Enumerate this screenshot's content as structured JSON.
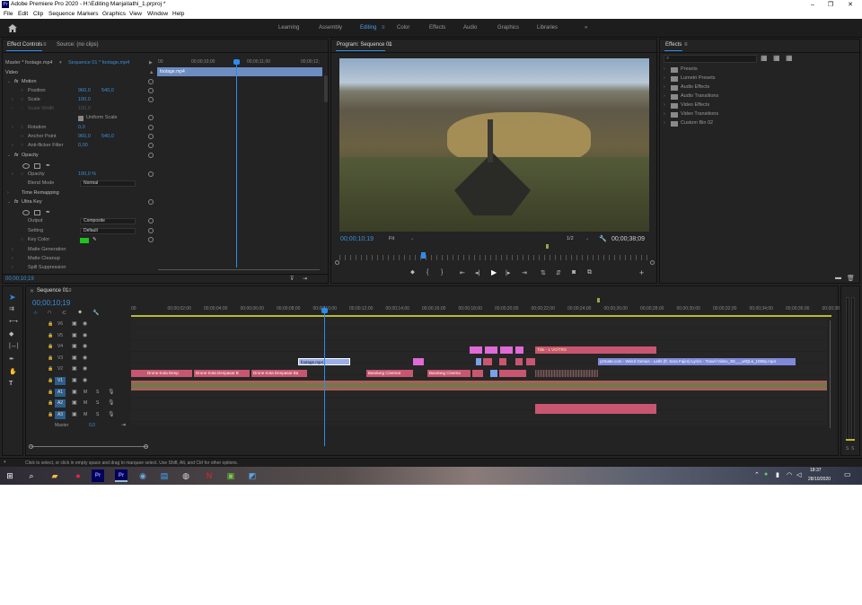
{
  "window": {
    "title": "Adobe Premiere Pro 2020 - H:\\Editing Manja\\lathi_1.prproj *",
    "app_badge": "Pr"
  },
  "menu": [
    "File",
    "Edit",
    "Clip",
    "Sequence",
    "Markers",
    "Graphics",
    "View",
    "Window",
    "Help"
  ],
  "workspaces": [
    "Learning",
    "Assembly",
    "Editing",
    "Color",
    "Effects",
    "Audio",
    "Graphics",
    "Libraries"
  ],
  "active_workspace": "Editing",
  "effect_controls": {
    "tab_label": "Effect Controls",
    "menu_glyph": "≡",
    "source_tab": "Source: (no clips)",
    "master_label": "Master * footage.mp4",
    "sequence_label": "Sequence 01 * footage.mp4",
    "timecodes": [
      "00",
      "00;00;10;00",
      "00;00;11;00",
      "00;00;12;"
    ],
    "clip_label": "footage.mp4",
    "video_header": "Video",
    "motion": "Motion",
    "position": {
      "label": "Position",
      "x": "960,0",
      "y": "540,0"
    },
    "scale": {
      "label": "Scale",
      "value": "100,0"
    },
    "scale_width": {
      "label": "Scale Width",
      "value": "100,0"
    },
    "uniform_scale": "Uniform Scale",
    "rotation": {
      "label": "Rotation",
      "value": "0,0"
    },
    "anchor_point": {
      "label": "Anchor Point",
      "x": "960,0",
      "y": "540,0"
    },
    "anti_flicker": {
      "label": "Anti-flicker Filter",
      "value": "0,00"
    },
    "opacity_header": "Opacity",
    "opacity": {
      "label": "Opacity",
      "value": "100,0 %"
    },
    "blend_mode": {
      "label": "Blend Mode",
      "value": "Normal"
    },
    "time_remapping": "Time Remapping",
    "ultra_key": "Ultra Key",
    "output": {
      "label": "Output",
      "value": "Composite"
    },
    "setting": {
      "label": "Setting",
      "value": "Default"
    },
    "key_color": {
      "label": "Key Color",
      "color": "#1ec31e"
    },
    "matte_generation": "Matte Generation",
    "matte_cleanup": "Matte Cleanup",
    "spill_suppression": "Spill Suppression",
    "footer_timecode": "00;00;10;19"
  },
  "program": {
    "tab_label": "Program: Sequence 01",
    "menu_glyph": "≡",
    "timecode": "00;00;10;19",
    "fit": "Fit",
    "resolution": "1/2",
    "duration": "00;00;38;09"
  },
  "effects": {
    "tab_label": "Effects",
    "menu_glyph": "≡",
    "search_placeholder": "",
    "folders": [
      "Presets",
      "Lumetri Presets",
      "Audio Effects",
      "Audio Transitions",
      "Video Effects",
      "Video Transitions",
      "Custom Bin 02"
    ]
  },
  "timeline": {
    "tab_label": "Sequence 01",
    "menu_glyph": "≡",
    "timecode": "00;00;10;19",
    "ruler": [
      "00",
      "00;00;02;00",
      "00;00;04;00",
      "00;00;06;00",
      "00;00;08;00",
      "00;00;10;00",
      "00;00;12;00",
      "00;00;14;00",
      "00;00;16;00",
      "00;00;18;00",
      "00;00;20;00",
      "00;00;22;00",
      "00;00;24;00",
      "00;00;26;00",
      "00;00;28;00",
      "00;00;30;00",
      "00;00;32;00",
      "00;00;34;00",
      "00;00;36;00",
      "00;00;38"
    ],
    "tracks": [
      "V6",
      "V5",
      "V4",
      "V3",
      "V2",
      "V1",
      "A1",
      "A2",
      "A3"
    ],
    "track_toggles": [
      "M",
      "S"
    ],
    "master": {
      "label": "Master",
      "value": "0,0"
    },
    "clips": {
      "footage": "footage.mp4",
      "drone1": "Drone Kota Denp",
      "drone2": "Drone Kota Denpasar B",
      "drone3": "Drone Kota Denpasar Ba",
      "bandung1": "Bandung Cinemat",
      "bandung2": "Bandung Cinema",
      "title": "Title - 1 VO/TRS",
      "y2mate": "y2mate.com - Weird Genius - Lathi (ft. Sara Fajira) Lyrics - Travel Video_3D___wtQLk_1080p.mp4"
    },
    "audio_meter": [
      "0",
      "S",
      "S"
    ]
  },
  "status_bar": "Click to select, or click in empty space and drag to marquee select. Use Shift, Alt, and Ctrl for other options.",
  "taskbar": {
    "time": "18:37",
    "date": "28/10/2020",
    "pinned": [
      "Pr"
    ]
  }
}
